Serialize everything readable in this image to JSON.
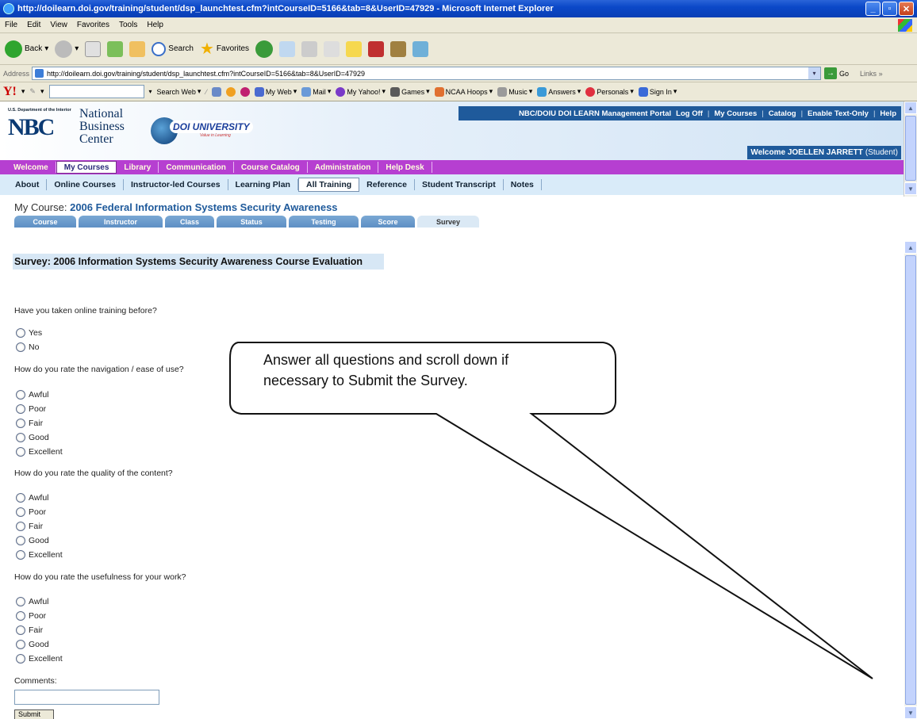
{
  "window": {
    "title": "http://doilearn.doi.gov/training/student/dsp_launchtest.cfm?intCourseID=5166&tab=8&UserID=47929 - Microsoft Internet Explorer"
  },
  "menu": [
    "File",
    "Edit",
    "View",
    "Favorites",
    "Tools",
    "Help"
  ],
  "toolbar": {
    "back": "Back",
    "search": "Search",
    "favorites": "Favorites"
  },
  "address": {
    "label": "Address",
    "url": "http://doilearn.doi.gov/training/student/dsp_launchtest.cfm?intCourseID=5166&tab=8&UserID=47929",
    "go": "Go",
    "links": "Links"
  },
  "yahoo": {
    "search_web": "Search Web",
    "items": [
      "My Web",
      "Mail",
      "My Yahoo!",
      "Games",
      "NCAA Hoops",
      "Music",
      "Answers",
      "Personals",
      "Sign In"
    ]
  },
  "nbc": {
    "dept": "U.S. Department of the Interior",
    "logo": "NBC",
    "name_lines": [
      "National",
      "Business",
      "Center"
    ],
    "doiu": "DOI UNIVERSITY",
    "doiu_tag": "Value in Learning",
    "portal_items": [
      "NBC/DOIU DOI LEARN Management Portal",
      "Log Off",
      "My Courses",
      "Catalog",
      "Enable Text-Only",
      "Help"
    ],
    "welcome_prefix": "Welcome",
    "user": "JOELLEN JARRETT",
    "role": "(Student)"
  },
  "main_nav": [
    "Welcome",
    "My Courses",
    "Library",
    "Communication",
    "Course Catalog",
    "Administration",
    "Help Desk"
  ],
  "main_nav_active": "My Courses",
  "sub_nav": [
    "About",
    "Online Courses",
    "Instructor-led Courses",
    "Learning Plan",
    "All Training",
    "Reference",
    "Student Transcript",
    "Notes"
  ],
  "sub_nav_active": "All Training",
  "course": {
    "prefix": "My Course:",
    "name": "2006 Federal Information Systems Security Awareness",
    "tabs": [
      "Course",
      "Instructor",
      "Class",
      "Status",
      "Testing",
      "Score",
      "Survey"
    ],
    "active_tab": "Survey"
  },
  "survey": {
    "title": "Survey: 2006 Information Systems Security Awareness Course Evaluation",
    "questions": [
      {
        "text": "Have you taken online training before?",
        "options": [
          "Yes",
          "No"
        ]
      },
      {
        "text": "How do you rate the navigation / ease of use?",
        "options": [
          "Awful",
          "Poor",
          "Fair",
          "Good",
          "Excellent"
        ]
      },
      {
        "text": "How do you rate the quality of the content?",
        "options": [
          "Awful",
          "Poor",
          "Fair",
          "Good",
          "Excellent"
        ]
      },
      {
        "text": "How do you rate the usefulness for your work?",
        "options": [
          "Awful",
          "Poor",
          "Fair",
          "Good",
          "Excellent"
        ]
      }
    ],
    "comments_label": "Comments:",
    "submit": "Submit"
  },
  "callout": {
    "line1": "Answer all questions and scroll down if",
    "line2": "necessary to Submit the Survey."
  }
}
